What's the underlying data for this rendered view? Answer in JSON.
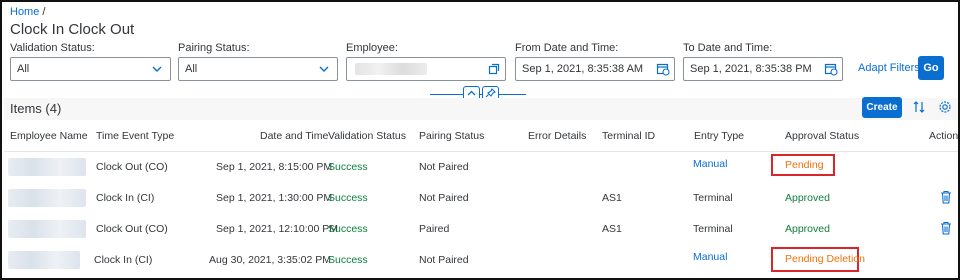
{
  "breadcrumb": {
    "home": "Home",
    "separator": "/"
  },
  "page_title": "Clock In Clock Out",
  "filters": {
    "validation_status": {
      "label": "Validation Status:",
      "value": "All"
    },
    "pairing_status": {
      "label": "Pairing Status:",
      "value": "All"
    },
    "employee": {
      "label": "Employee:",
      "value": ""
    },
    "from_date": {
      "label": "From Date and Time:",
      "value": "Sep 1, 2021, 8:35:38 AM"
    },
    "to_date": {
      "label": "To Date and Time:",
      "value": "Sep 1, 2021, 8:35:38 PM"
    },
    "adapt_filters": "Adapt Filters",
    "go": "Go"
  },
  "table": {
    "title": "Items (4)",
    "create": "Create",
    "columns": [
      "Employee Name",
      "Time Event Type",
      "Date and Time",
      "Validation Status",
      "Pairing Status",
      "Error Details",
      "Terminal ID",
      "Entry Type",
      "Approval Status",
      "Actions"
    ],
    "rows": [
      {
        "employee": "",
        "event_type": "Clock Out (CO)",
        "date_time": "Sep 1, 2021, 8:15:00 PM",
        "validation": "Success",
        "pairing": "Not Paired",
        "error": "",
        "terminal": "",
        "entry": "Manual",
        "approval": "Pending",
        "action": ""
      },
      {
        "employee": "",
        "event_type": "Clock In (CI)",
        "date_time": "Sep 1, 2021, 1:30:00 PM",
        "validation": "Success",
        "pairing": "Not Paired",
        "error": "",
        "terminal": "AS1",
        "entry": "Terminal",
        "approval": "Approved",
        "action": "delete-icon"
      },
      {
        "employee": "",
        "event_type": "Clock Out (CO)",
        "date_time": "Sep 1, 2021, 12:10:00 PM",
        "validation": "Success",
        "pairing": "Paired",
        "error": "",
        "terminal": "AS1",
        "entry": "Terminal",
        "approval": "Approved",
        "action": "delete-icon"
      },
      {
        "employee": "",
        "event_type": "Clock In (CI)",
        "date_time": "Aug 30, 2021, 3:35:02 PM",
        "validation": "Success",
        "pairing": "Not Paired",
        "error": "",
        "terminal": "",
        "entry": "Manual",
        "approval": "Pending Deletion",
        "action": ""
      }
    ]
  },
  "colors": {
    "accent": "#0a6ed1",
    "success": "#107e3e",
    "pending": "#e9730c",
    "highlight_box": "#d8262a"
  }
}
